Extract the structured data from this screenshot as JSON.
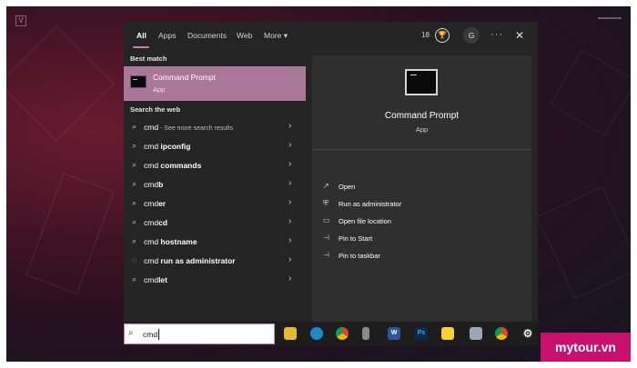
{
  "tabs": [
    {
      "label": "All"
    },
    {
      "label": "Apps"
    },
    {
      "label": "Documents"
    },
    {
      "label": "Web"
    },
    {
      "label": "More ▾"
    }
  ],
  "header": {
    "count": "18",
    "avatar_initial": "G",
    "more_dots": "···",
    "close": "✕"
  },
  "sections": {
    "best_match": "Best match",
    "search_web": "Search the web"
  },
  "best_match": {
    "title": "Command Prompt",
    "subtitle": "App"
  },
  "web_results": [
    {
      "term": "cmd",
      "suffix": " - See more search results"
    },
    {
      "term": "cmd ",
      "bold": "ipconfig"
    },
    {
      "term": "cmd ",
      "bold": "commands"
    },
    {
      "term": "cmd",
      "bold": "b"
    },
    {
      "term": "cmd",
      "bold": "er"
    },
    {
      "term": "cmd",
      "bold": "cd"
    },
    {
      "term": "cmd ",
      "bold": "hostname"
    },
    {
      "term": "cmd ",
      "bold": "run as administrator"
    },
    {
      "term": "cmd",
      "bold": "let"
    }
  ],
  "preview": {
    "title": "Command Prompt",
    "subtitle": "App"
  },
  "actions": [
    {
      "label": "Open",
      "icon": "open-icon"
    },
    {
      "label": "Run as administrator",
      "icon": "shield-icon"
    },
    {
      "label": "Open file location",
      "icon": "folder-icon"
    },
    {
      "label": "Pin to Start",
      "icon": "pin-icon"
    },
    {
      "label": "Pin to taskbar",
      "icon": "pin-icon"
    }
  ],
  "search": {
    "value": "cmd"
  },
  "taskbar_icons": [
    "file-explorer-icon",
    "edge-icon",
    "chrome-icon",
    "usb-icon",
    "word-icon",
    "photoshop-icon",
    "sticky-notes-icon",
    "network-icon",
    "chrome-icon",
    "settings-icon"
  ],
  "watermark": "mytour.vn",
  "colors": {
    "accent": "#d37ab2",
    "selected": "#a8779a",
    "panel": "#242424",
    "watermark": "#c9106d"
  }
}
